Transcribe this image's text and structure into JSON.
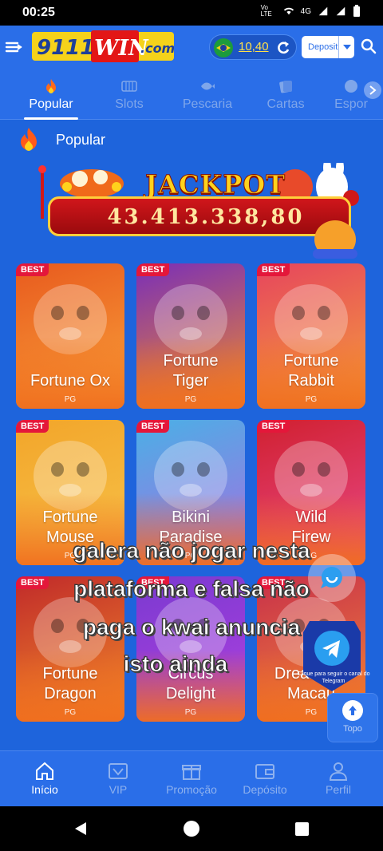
{
  "status_bar": {
    "time": "00:25",
    "network": "4G",
    "carrier_tag": "Vo LTE"
  },
  "header": {
    "logo_text": "9111WIN.com",
    "balance": "10,40",
    "deposit_label": "Deposit"
  },
  "tabs": [
    {
      "label": "Popular",
      "active": true
    },
    {
      "label": "Slots",
      "active": false
    },
    {
      "label": "Pescaria",
      "active": false
    },
    {
      "label": "Cartas",
      "active": false
    },
    {
      "label": "Espor",
      "active": false
    }
  ],
  "section": {
    "title": "Popular"
  },
  "jackpot": {
    "title": "JACKPOT",
    "value": "43.413.338,80"
  },
  "games": [
    {
      "badge": "BEST",
      "line1": "Fortune Ox",
      "line2": "",
      "provider": "PG",
      "color_top": "#e85a1e",
      "color_bottom": "#f9a23a"
    },
    {
      "badge": "BEST",
      "line1": "Fortune",
      "line2": "Tiger",
      "provider": "PG",
      "color_top": "#7a2fb8",
      "color_bottom": "#f08a2a"
    },
    {
      "badge": "BEST",
      "line1": "Fortune",
      "line2": "Rabbit",
      "provider": "PG",
      "color_top": "#e6455d",
      "color_bottom": "#f5a03c"
    },
    {
      "badge": "BEST",
      "line1": "Fortune",
      "line2": "Mouse",
      "provider": "PG",
      "color_top": "#f2a52a",
      "color_bottom": "#f7c34a"
    },
    {
      "badge": "BEST",
      "line1": "Bikini",
      "line2": "Paradise",
      "provider": "PG",
      "color_top": "#4ab0e6",
      "color_bottom": "#a96ce0"
    },
    {
      "badge": "BEST",
      "line1": "Wild",
      "line2": "Firew",
      "provider": "PG",
      "color_top": "#d02030",
      "color_bottom": "#e94a8a"
    },
    {
      "badge": "BEST",
      "line1": "Fortune",
      "line2": "Dragon",
      "provider": "PG",
      "color_top": "#c02a2a",
      "color_bottom": "#f28a2a"
    },
    {
      "badge": "BEST",
      "line1": "Circus",
      "line2": "Delight",
      "provider": "PG",
      "color_top": "#7a3ad0",
      "color_bottom": "#b040e0"
    },
    {
      "badge": "BEST",
      "line1": "Dreams of",
      "line2": "Macau",
      "provider": "PG",
      "color_top": "#c8304a",
      "color_bottom": "#f0843a"
    }
  ],
  "overlay_caption": [
    "galera não jogar nesta",
    "plataforma e falsa não",
    "paga o kwai anuncia",
    "isto ainda"
  ],
  "telegram_hint": "Clique para seguir o canal do Telegram",
  "topo_label": "Topo",
  "bottom_nav": [
    {
      "label": "Início",
      "active": true,
      "icon": "home-icon"
    },
    {
      "label": "VIP",
      "active": false,
      "icon": "vip-icon"
    },
    {
      "label": "Promoção",
      "active": false,
      "icon": "gift-icon"
    },
    {
      "label": "Depósito",
      "active": false,
      "icon": "wallet-icon"
    },
    {
      "label": "Perfil",
      "active": false,
      "icon": "profile-icon"
    }
  ]
}
